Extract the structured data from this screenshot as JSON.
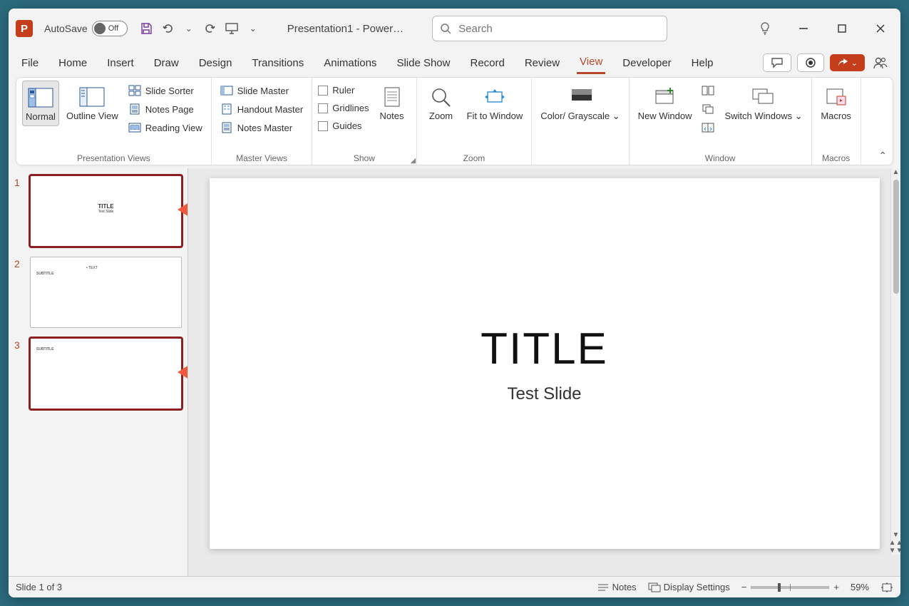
{
  "autosave": {
    "label": "AutoSave",
    "state": "Off"
  },
  "title": "Presentation1  -  Power…",
  "search": {
    "placeholder": "Search"
  },
  "tabs": [
    "File",
    "Home",
    "Insert",
    "Draw",
    "Design",
    "Transitions",
    "Animations",
    "Slide Show",
    "Record",
    "Review",
    "View",
    "Developer",
    "Help"
  ],
  "active_tab": "View",
  "ribbon": {
    "presentation_views": {
      "label": "Presentation Views",
      "normal": "Normal",
      "outline": "Outline View",
      "slide_sorter": "Slide Sorter",
      "notes_page": "Notes Page",
      "reading_view": "Reading View"
    },
    "master_views": {
      "label": "Master Views",
      "slide_master": "Slide Master",
      "handout_master": "Handout Master",
      "notes_master": "Notes Master"
    },
    "show": {
      "label": "Show",
      "ruler": "Ruler",
      "gridlines": "Gridlines",
      "guides": "Guides",
      "notes": "Notes"
    },
    "zoom": {
      "label": "Zoom",
      "zoom": "Zoom",
      "fit": "Fit to Window"
    },
    "color": {
      "label": "Color/ Grayscale"
    },
    "window": {
      "label": "Window",
      "new_window": "New Window",
      "switch": "Switch Windows"
    },
    "macros": {
      "label": "Macros",
      "macros": "Macros"
    }
  },
  "thumbnails": [
    {
      "n": "1",
      "title": "TITLE",
      "sub": "Test Slide",
      "selected": true,
      "arrow": true
    },
    {
      "n": "2",
      "left": "SUBTITLE",
      "right": "• TEXT",
      "selected": false,
      "arrow": false
    },
    {
      "n": "3",
      "left": "SUBTITLE",
      "selected": true,
      "arrow": true
    }
  ],
  "slide": {
    "title": "TITLE",
    "subtitle": "Test Slide"
  },
  "status": {
    "slide_info": "Slide 1 of 3",
    "notes": "Notes",
    "display": "Display Settings",
    "zoom": "59%"
  }
}
